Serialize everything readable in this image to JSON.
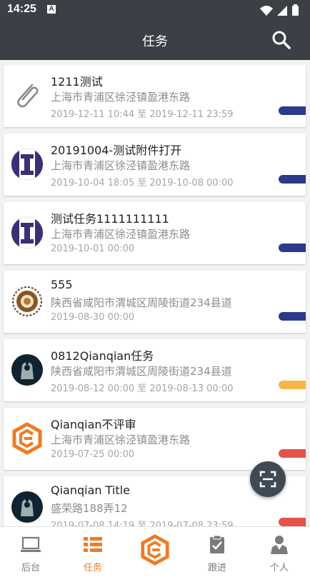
{
  "status_bar": {
    "time": "14:25",
    "notification_icon": "A"
  },
  "app_bar": {
    "title": "任务",
    "search_icon": "search-icon"
  },
  "tasks": [
    {
      "title": "1211测试",
      "address": "上海市青浦区徐泾镇盈港东路",
      "date": "2019-12-11 10:44 至 2019-12-11 23:59",
      "logo": "paperclip-icon",
      "status_color": "#2b3a8a"
    },
    {
      "title": "20191004-测试附件打开",
      "address": "上海市青浦区徐泾镇盈港东路",
      "date": "2019-10-04 18:05 至 2019-10-08 00:00",
      "logo": "purple-i-logo",
      "status_color": "#2b3a8a"
    },
    {
      "title": "测试任务1111111111",
      "address": "上海市青浦区徐泾镇盈港东路",
      "date": "2019-10-01 00:00",
      "logo": "purple-i-logo",
      "status_color": "#2b3a8a"
    },
    {
      "title": "555",
      "address": "陕西省咸阳市渭城区周陵街道234县道",
      "date": "2019-08-30 00:00",
      "logo": "bronze-badge-logo",
      "status_color": "#2b3a8a"
    },
    {
      "title": "0812Qianqian任务",
      "address": "陕西省咸阳市渭城区周陵街道234县道",
      "date": "2019-08-12 00:00 至 2019-08-13 00:00",
      "logo": "dark-photo-logo",
      "status_color": "#f5b74a"
    },
    {
      "title": "Qianqian不评审",
      "address": "上海市青浦区徐泾镇盈港东路",
      "date": "2019-07-25 00:00",
      "logo": "orange-hex-logo",
      "status_color": "#e4534a"
    },
    {
      "title": "Qianqian Title",
      "address": "盛荣路188弄12",
      "date": "2019-07-08 14:19 至 2019-07-08 23:59",
      "logo": "dark-photo-logo",
      "status_color": "#e4534a"
    }
  ],
  "fab": {
    "icon": "scan-icon"
  },
  "tabs": [
    {
      "label": "后台",
      "icon": "laptop-icon",
      "active": false
    },
    {
      "label": "任务",
      "icon": "list-icon",
      "active": true
    },
    {
      "label": "",
      "icon": "center-logo-icon",
      "active": false
    },
    {
      "label": "跟进",
      "icon": "clipboard-check-icon",
      "active": false
    },
    {
      "label": "个人",
      "icon": "person-icon",
      "active": false
    }
  ],
  "colors": {
    "header": "#3a4046",
    "accent": "#ef7b22",
    "status_blue": "#2b3a8a",
    "status_yellow": "#f5b74a",
    "status_red": "#e4534a"
  }
}
